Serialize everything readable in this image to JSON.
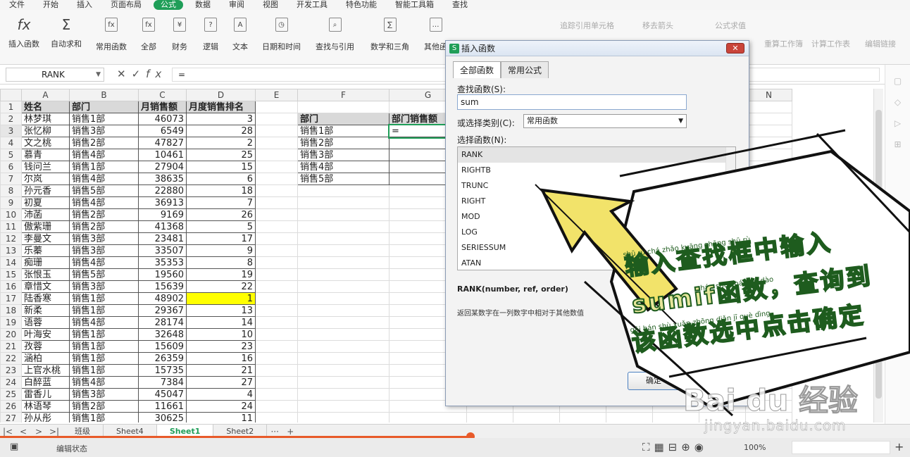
{
  "menubar": [
    "文件",
    "开始",
    "插入",
    "页面布局",
    "公式",
    "数据",
    "审阅",
    "视图",
    "开发工具",
    "特色功能",
    "智能工具箱",
    "查找"
  ],
  "menu_active_index": 4,
  "ribbon": {
    "buttons": [
      "插入函数",
      "自动求和",
      "常用函数",
      "全部",
      "财务",
      "逻辑",
      "文本",
      "日期和时间",
      "查找与引用",
      "数学和三角",
      "其他函"
    ],
    "icons": [
      "fx",
      "Σ",
      "fx",
      "fx",
      "¥",
      "?",
      "A",
      "◷",
      "⌕",
      "∑",
      "…"
    ],
    "right": [
      "追踪引用单元格",
      "移去箭头",
      "公式求值",
      "重算工作簿",
      "计算工作表",
      "编辑链接"
    ]
  },
  "formula": {
    "namebox": "RANK",
    "fx": "fx",
    "value": "="
  },
  "columns": [
    "A",
    "B",
    "C",
    "D",
    "E",
    "F",
    "G",
    "H",
    "I",
    "J",
    "K",
    "L",
    "M",
    "N"
  ],
  "rows": [
    {
      "n": "1",
      "a": "姓名",
      "b": "部门",
      "c": "月销售额",
      "d": "月度销售排名",
      "f": "",
      "g": ""
    },
    {
      "n": "2",
      "a": "林梦琪",
      "b": "销售1部",
      "c": "46073",
      "d": "3",
      "f": "部门",
      "g": "部门销售额"
    },
    {
      "n": "3",
      "a": "张忆柳",
      "b": "销售3部",
      "c": "6549",
      "d": "28",
      "f": "销售1部",
      "g": "="
    },
    {
      "n": "4",
      "a": "文之桃",
      "b": "销售2部",
      "c": "47827",
      "d": "2",
      "f": "销售2部",
      "g": ""
    },
    {
      "n": "5",
      "a": "慕青",
      "b": "销售4部",
      "c": "10461",
      "d": "25",
      "f": "销售3部",
      "g": ""
    },
    {
      "n": "6",
      "a": "钱问兰",
      "b": "销售1部",
      "c": "27904",
      "d": "15",
      "f": "销售4部",
      "g": ""
    },
    {
      "n": "7",
      "a": "尔岚",
      "b": "销售4部",
      "c": "38635",
      "d": "6",
      "f": "销售5部",
      "g": ""
    },
    {
      "n": "8",
      "a": "孙元香",
      "b": "销售5部",
      "c": "22880",
      "d": "18",
      "f": "",
      "g": ""
    },
    {
      "n": "9",
      "a": "初夏",
      "b": "销售4部",
      "c": "36913",
      "d": "7",
      "f": "",
      "g": ""
    },
    {
      "n": "10",
      "a": "沛菡",
      "b": "销售2部",
      "c": "9169",
      "d": "26",
      "f": "",
      "g": ""
    },
    {
      "n": "11",
      "a": "傲紫珊",
      "b": "销售2部",
      "c": "41368",
      "d": "5",
      "f": "",
      "g": ""
    },
    {
      "n": "12",
      "a": "李曼文",
      "b": "销售3部",
      "c": "23481",
      "d": "17",
      "f": "",
      "g": ""
    },
    {
      "n": "13",
      "a": "乐蓁",
      "b": "销售3部",
      "c": "33507",
      "d": "9",
      "f": "",
      "g": ""
    },
    {
      "n": "14",
      "a": "痴珊",
      "b": "销售4部",
      "c": "35353",
      "d": "8",
      "f": "",
      "g": ""
    },
    {
      "n": "15",
      "a": "张恨玉",
      "b": "销售5部",
      "c": "19560",
      "d": "19",
      "f": "",
      "g": ""
    },
    {
      "n": "16",
      "a": "章惜文",
      "b": "销售3部",
      "c": "15639",
      "d": "22",
      "f": "",
      "g": ""
    },
    {
      "n": "17",
      "a": "陆香寒",
      "b": "销售1部",
      "c": "48902",
      "d": "1",
      "f": "",
      "g": ""
    },
    {
      "n": "18",
      "a": "新柔",
      "b": "销售1部",
      "c": "29367",
      "d": "13",
      "f": "",
      "g": ""
    },
    {
      "n": "19",
      "a": "语蓉",
      "b": "销售4部",
      "c": "28174",
      "d": "14",
      "f": "",
      "g": ""
    },
    {
      "n": "20",
      "a": "叶海安",
      "b": "销售1部",
      "c": "32648",
      "d": "10",
      "f": "",
      "g": ""
    },
    {
      "n": "21",
      "a": "孜蓉",
      "b": "销售1部",
      "c": "15609",
      "d": "23",
      "f": "",
      "g": ""
    },
    {
      "n": "22",
      "a": "涵柏",
      "b": "销售1部",
      "c": "26359",
      "d": "16",
      "f": "",
      "g": ""
    },
    {
      "n": "23",
      "a": "上官水桃",
      "b": "销售1部",
      "c": "15735",
      "d": "21",
      "f": "",
      "g": ""
    },
    {
      "n": "24",
      "a": "白醉蓝",
      "b": "销售4部",
      "c": "7384",
      "d": "27",
      "f": "",
      "g": ""
    },
    {
      "n": "25",
      "a": "雷香儿",
      "b": "销售3部",
      "c": "45047",
      "d": "4",
      "f": "",
      "g": ""
    },
    {
      "n": "26",
      "a": "林语琴",
      "b": "销售2部",
      "c": "11661",
      "d": "24",
      "f": "",
      "g": ""
    },
    {
      "n": "27",
      "a": "孙从彤",
      "b": "销售1部",
      "c": "30625",
      "d": "11",
      "f": "",
      "g": ""
    }
  ],
  "highlight": {
    "color": "#ffff00"
  },
  "sheet_tabs": [
    "班级",
    "Sheet4",
    "Sheet1",
    "Sheet2"
  ],
  "sheet_active": "Sheet1",
  "status": {
    "text": "编辑状态",
    "zoom": "100%"
  },
  "progress": 0.517,
  "dialog": {
    "title": "插入函数",
    "tabs": [
      "全部函数",
      "常用公式"
    ],
    "search_label": "查找函数(S):",
    "search_value": "sum",
    "category_label": "或选择类别(C):",
    "category_value": "常用函数",
    "list_label": "选择函数(N):",
    "functions": [
      "RANK",
      "RIGHTB",
      "TRUNC",
      "RIGHT",
      "MOD",
      "LOG",
      "SERIESSUM",
      "ATAN"
    ],
    "signature": "RANK(number, ref, order)",
    "description": "返回某数字在一列数字中相对于其他数值",
    "ok": "确定"
  },
  "caption": {
    "line1": "输入查找框中输入",
    "line2": "sumif函数，查询到",
    "line3": "该函数选中点击确定",
    "pinyin1": "shū rù chá zhǎo kuāng zhōng shū rù",
    "pinyin2": "hán shù chá xún dào",
    "pinyin3": "gāi hán shù xuǎn zhōng diǎn jī què dìng"
  },
  "watermark": "Bai du 经验",
  "watermark_url": "jingyan.baidu.com"
}
